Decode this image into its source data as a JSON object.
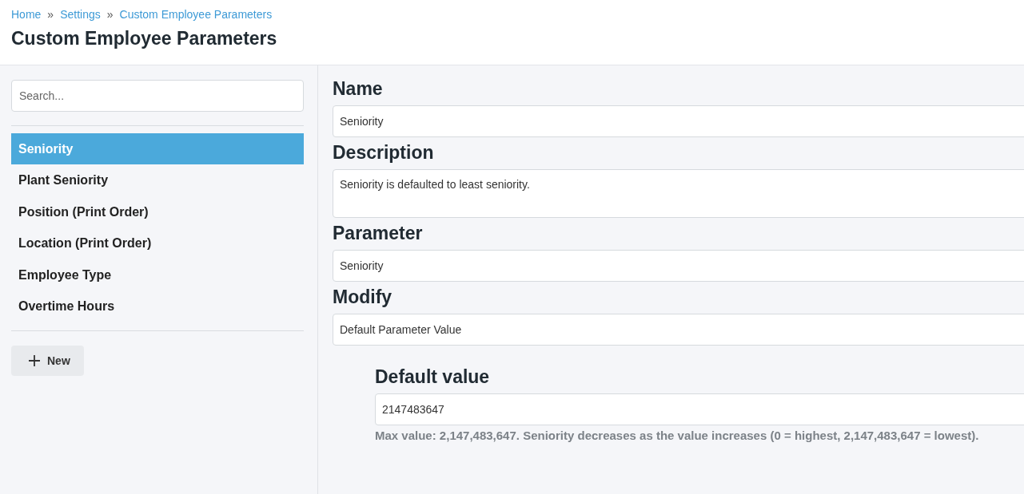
{
  "breadcrumb": [
    {
      "label": "Home"
    },
    {
      "label": "Settings"
    },
    {
      "label": "Custom Employee Parameters"
    }
  ],
  "breadcrumb_separator": "»",
  "title": "Custom Employee Parameters",
  "sidebar": {
    "search": {
      "placeholder": "Search..."
    },
    "items": [
      {
        "label": "Seniority",
        "selected": true
      },
      {
        "label": "Plant Seniority",
        "selected": false
      },
      {
        "label": "Position (Print Order)",
        "selected": false
      },
      {
        "label": "Location (Print Order)",
        "selected": false
      },
      {
        "label": "Employee Type",
        "selected": false
      },
      {
        "label": "Overtime Hours",
        "selected": false
      }
    ],
    "new_button": "New"
  },
  "form": {
    "fields": [
      {
        "label": "Name",
        "kind": "input",
        "value": "Seniority"
      },
      {
        "label": "Description",
        "kind": "textarea",
        "value": "Seniority is defaulted to least seniority."
      },
      {
        "label": "Parameter",
        "kind": "input",
        "value": "Seniority"
      },
      {
        "label": "Modify",
        "kind": "input",
        "value": "Default Parameter Value"
      }
    ],
    "default_value": {
      "label": "Default value",
      "value": "2147483647",
      "help": "Max value: 2,147,483,647. Seniority decreases as the value increases (0 = highest, 2,147,483,647 = lowest)."
    }
  }
}
